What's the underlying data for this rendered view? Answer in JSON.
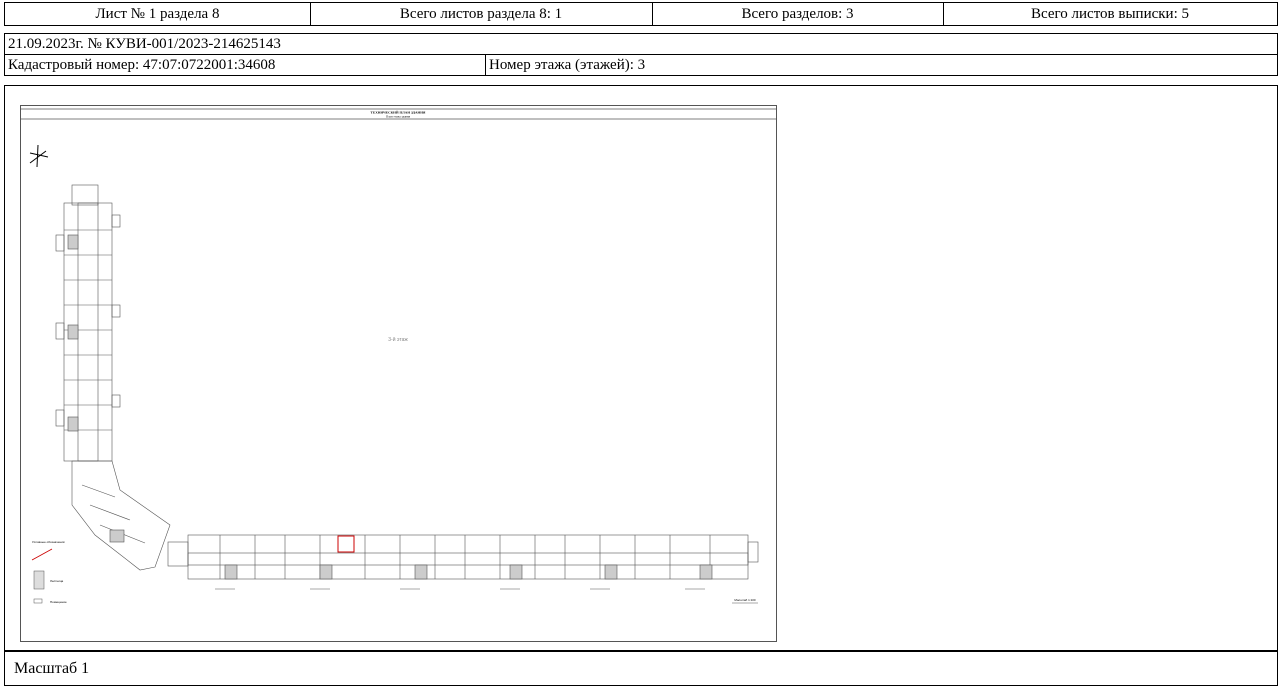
{
  "header": {
    "sheet_label": "Лист № 1 раздела 8",
    "sheets_in_section": "Всего листов раздела 8: 1",
    "total_sections": "Всего разделов: 3",
    "total_sheets": "Всего листов выписки: 5"
  },
  "record": {
    "date_number": "21.09.2023г. № КУВИ-001/2023-214625143",
    "cadastral_number": "Кадастровый номер: 47:07:0722001:34608",
    "floor_number": "Номер этажа (этажей): 3"
  },
  "plan": {
    "title_line1": "ТЕХНИЧЕСКИЙ ПЛАН ЗДАНИЯ",
    "title_line2": "План этажа здания",
    "floor_caption": "3-й этаж",
    "legend_label1": "Условные обозначения:",
    "legend_label2": "Лестница",
    "legend_label3": "Помещение",
    "scale_note": "Масштаб 1:100"
  },
  "footer": {
    "scale_label": "Масштаб 1"
  },
  "colors": {
    "border": "#000000",
    "plan_line": "#444444",
    "highlight": "#cc0000"
  }
}
